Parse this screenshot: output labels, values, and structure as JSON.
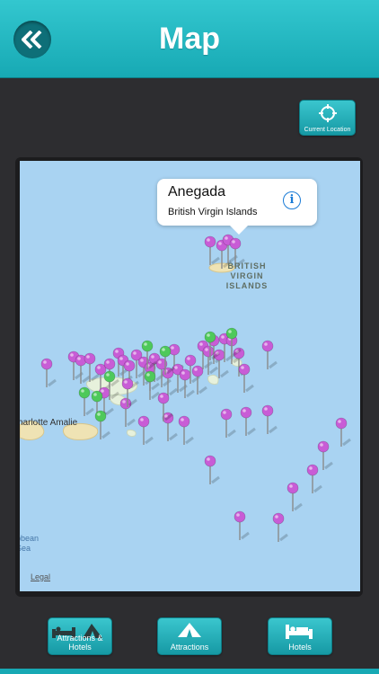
{
  "header": {
    "title": "Map",
    "back_icon": "double-chevron-left-icon"
  },
  "current_location": {
    "label": "Current Location",
    "icon": "crosshair-icon"
  },
  "callout": {
    "title": "Anegada",
    "subtitle": "British Virgin Islands",
    "info_icon": "info-icon"
  },
  "map": {
    "labels": {
      "islands": "BRITISH VIRGIN ISLANDS",
      "town": "harlotte Amalie",
      "sea": "bbean Sea",
      "legal": "Legal"
    },
    "pin_colors": {
      "attraction": "#c85cd6",
      "hotel": "#4ec95a"
    }
  },
  "tabs": [
    {
      "label": "Attractions & Hotels",
      "icon": "bed-and-tent-icon"
    },
    {
      "label": "Attractions",
      "icon": "tent-icon"
    },
    {
      "label": "Hotels",
      "icon": "bed-icon"
    }
  ]
}
